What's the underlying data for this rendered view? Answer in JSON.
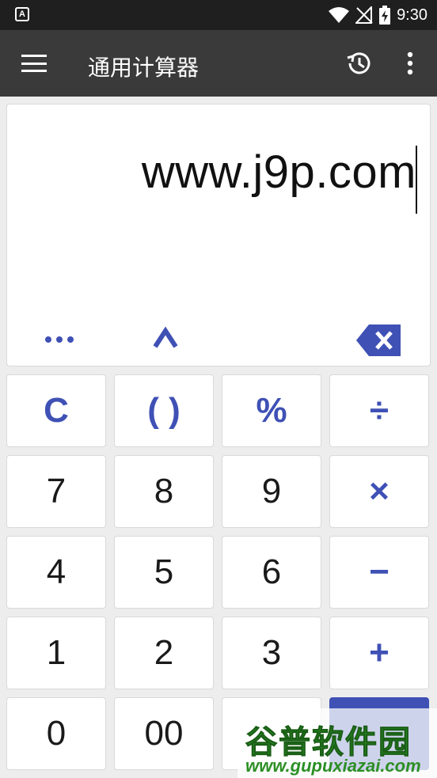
{
  "status": {
    "time": "9:30"
  },
  "app": {
    "title": "通用计算器"
  },
  "display": {
    "expression": "www.j9p.com"
  },
  "keys": {
    "clear": "C",
    "parens": "( )",
    "percent": "%",
    "divide": "÷",
    "seven": "7",
    "eight": "8",
    "nine": "9",
    "multiply": "×",
    "four": "4",
    "five": "5",
    "six": "6",
    "minus": "−",
    "one": "1",
    "two": "2",
    "three": "3",
    "plus": "+",
    "zero": "0",
    "double_zero": "00"
  },
  "watermark": {
    "name": "谷普软件园",
    "url": "www.gupuxiazai.com"
  },
  "colors": {
    "accent": "#3f51b5",
    "appbar": "#3a3a3a",
    "statusbar": "#1f1f1f"
  },
  "icons": [
    "notification-a-icon",
    "wifi-icon",
    "no-signal-icon",
    "battery-charging-icon",
    "menu-icon",
    "history-icon",
    "more-vert-icon",
    "more-functions-icon",
    "power-icon",
    "backspace-icon"
  ]
}
